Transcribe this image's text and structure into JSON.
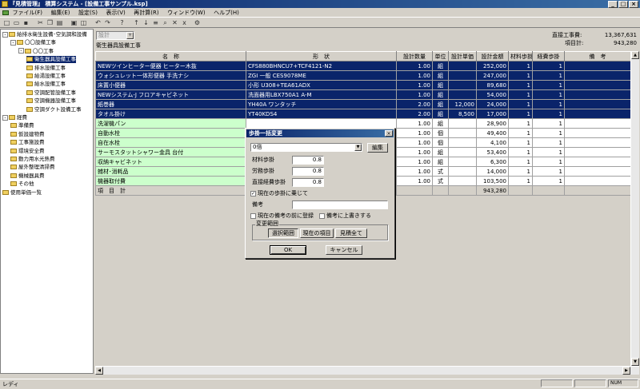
{
  "window": {
    "title": "『見積管理』 積算システム - [設備工事サンプル.ksp]"
  },
  "menu": [
    "ファイル(F)",
    "編集(E)",
    "設定(S)",
    "表示(V)",
    "再計算(R)",
    "ウィンドウ(W)",
    "ヘルプ(H)"
  ],
  "tree": [
    {
      "label": "給排水衛生設備･空気調和設備",
      "level": 0,
      "toggle": "-"
    },
    {
      "label": "〇〇設備工事",
      "level": 1,
      "toggle": "-"
    },
    {
      "label": "〇〇工事",
      "level": 2,
      "toggle": "-"
    },
    {
      "label": "衛生器具設備工事",
      "level": 3,
      "selected": true
    },
    {
      "label": "排水設備工事",
      "level": 3
    },
    {
      "label": "給湯設備工事",
      "level": 3
    },
    {
      "label": "給水設備工事",
      "level": 3
    },
    {
      "label": "空調配管設備工事",
      "level": 3
    },
    {
      "label": "空調機器設備工事",
      "level": 3
    },
    {
      "label": "空調ダクト設備工事",
      "level": 3
    },
    {
      "label": "経費",
      "level": 0,
      "toggle": "-"
    },
    {
      "label": "準備費",
      "level": 1
    },
    {
      "label": "仮設建物費",
      "level": 1
    },
    {
      "label": "工事施設費",
      "level": 1
    },
    {
      "label": "環境安全費",
      "level": 1
    },
    {
      "label": "動力用水光熱費",
      "level": 1
    },
    {
      "label": "屋外整理清掃費",
      "level": 1
    },
    {
      "label": "機械器具費",
      "level": 1
    },
    {
      "label": "その他",
      "level": 1
    },
    {
      "label": "使用単価一覧",
      "level": 0
    }
  ],
  "header": {
    "filter_value": "設計",
    "section_title": "衛生器具設備工事",
    "direct_cost_label": "直接工事費:",
    "direct_cost_value": "13,367,631",
    "item_total_label": "項目計:",
    "item_total_value": "943,280"
  },
  "table": {
    "columns": [
      "名　称",
      "形　状",
      "設計数量",
      "単位",
      "設計単価",
      "設計金額",
      "材料歩掛",
      "経費歩掛",
      "備　考"
    ],
    "rows": [
      {
        "name": "NEWツインヒーター便器 ヒーター木抜",
        "shape": "CFS880BHNCU7+TCF4121-N2",
        "qty": "1.00",
        "unit": "組",
        "price": "",
        "amount": "252,000",
        "mat": "1",
        "exp": "1",
        "note": "",
        "style": "sel"
      },
      {
        "name": "ウォシュレット一体形便器 手洗ナシ",
        "shape": "ZGI 一般 CES9078ME",
        "qty": "1.00",
        "unit": "組",
        "price": "",
        "amount": "247,000",
        "mat": "1",
        "exp": "1",
        "note": "",
        "style": "sel"
      },
      {
        "name": "床置小便器",
        "shape": "小形 U308+TEA61ADX",
        "qty": "1.00",
        "unit": "組",
        "price": "",
        "amount": "89,680",
        "mat": "1",
        "exp": "1",
        "note": "",
        "style": "sel"
      },
      {
        "name": "NEWシステム-J フロアキャビネット",
        "shape": "洗面器用LBX750A1 A-M",
        "qty": "1.00",
        "unit": "組",
        "price": "",
        "amount": "54,000",
        "mat": "1",
        "exp": "1",
        "note": "",
        "style": "sel"
      },
      {
        "name": "紙巻器",
        "shape": "YH40A ワンタッチ",
        "qty": "2.00",
        "unit": "組",
        "price": "12,000",
        "amount": "24,000",
        "mat": "1",
        "exp": "1",
        "note": "",
        "style": "sel"
      },
      {
        "name": "タオル掛け",
        "shape": "YT40KDS4",
        "qty": "2.00",
        "unit": "組",
        "price": "8,500",
        "amount": "17,000",
        "mat": "1",
        "exp": "1",
        "note": "",
        "style": "sel"
      },
      {
        "name": "洗濯機パン",
        "shape": "",
        "qty": "1.00",
        "unit": "組",
        "price": "",
        "amount": "28,900",
        "mat": "1",
        "exp": "1",
        "note": "",
        "style": "grn"
      },
      {
        "name": "自動水栓",
        "shape": "",
        "qty": "1.00",
        "unit": "個",
        "price": "",
        "amount": "49,400",
        "mat": "1",
        "exp": "1",
        "note": "",
        "style": "grn"
      },
      {
        "name": "自在水栓",
        "shape": "",
        "qty": "1.00",
        "unit": "個",
        "price": "",
        "amount": "4,100",
        "mat": "1",
        "exp": "1",
        "note": "",
        "style": "grn"
      },
      {
        "name": "サーモスタットシャワー金具 台付",
        "shape": "",
        "qty": "1.00",
        "unit": "組",
        "price": "",
        "amount": "53,400",
        "mat": "1",
        "exp": "1",
        "note": "",
        "style": "grn"
      },
      {
        "name": "収納キャビネット",
        "shape": "",
        "qty": "1.00",
        "unit": "組",
        "price": "",
        "amount": "6,300",
        "mat": "1",
        "exp": "1",
        "note": "",
        "style": "grn"
      },
      {
        "name": "雑材･消耗品",
        "shape": "",
        "qty": "1.00",
        "unit": "式",
        "price": "",
        "amount": "14,000",
        "mat": "1",
        "exp": "1",
        "note": "",
        "style": "grn"
      },
      {
        "name": "機器取付費",
        "shape": "",
        "qty": "1.00",
        "unit": "式",
        "price": "",
        "amount": "103,500",
        "mat": "1",
        "exp": "1",
        "note": "",
        "style": "grn"
      }
    ],
    "total_label": "項　目　計",
    "total_amount": "943,280"
  },
  "dialog": {
    "title": "歩掛一括変更",
    "preset_value": "0倍",
    "edit_button": "編集",
    "material_label": "材料歩掛",
    "material_value": "0.8",
    "labor_label": "労務歩掛",
    "labor_value": "0.8",
    "direct_label": "直接経費歩掛",
    "direct_value": "0.8",
    "keep_checkbox": "現在の歩掛に乗じて",
    "keep_checked": true,
    "note_label": "備考",
    "note_value": "",
    "prepend_checkbox": "現在の備考の前に登録",
    "overwrite_checkbox": "備考に上書きする",
    "range_label": "変更範囲",
    "range_selected": "選択範囲",
    "range_current": "現在の項目",
    "range_all": "見積全て",
    "ok": "OK",
    "cancel": "キャンセル"
  },
  "status": {
    "left": "レディ",
    "num": "NUM"
  }
}
